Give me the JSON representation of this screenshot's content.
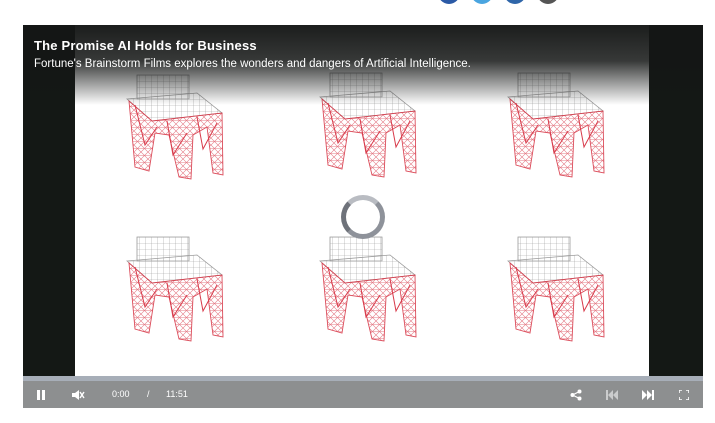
{
  "video": {
    "title": "The Promise AI Holds for Business",
    "subtitle": "Fortune's Brainstorm Films explores the wonders and dangers of Artificial Intelligence."
  },
  "controls": {
    "current_time": "0:00",
    "separator": "/",
    "duration": "11:51",
    "play_state_icon": "pause-icon",
    "mute_state_icon": "muted-speaker-icon",
    "progress_fraction": 0.0
  },
  "colors": {
    "player_bg": "#141815",
    "control_bar": "#8d8f90",
    "progress_bar": "#a7aeb8",
    "share_dots": [
      "#2b5aa6",
      "#4aa5e0",
      "#2f66a9",
      "#555555"
    ],
    "wireframe": "#d83a4a"
  }
}
